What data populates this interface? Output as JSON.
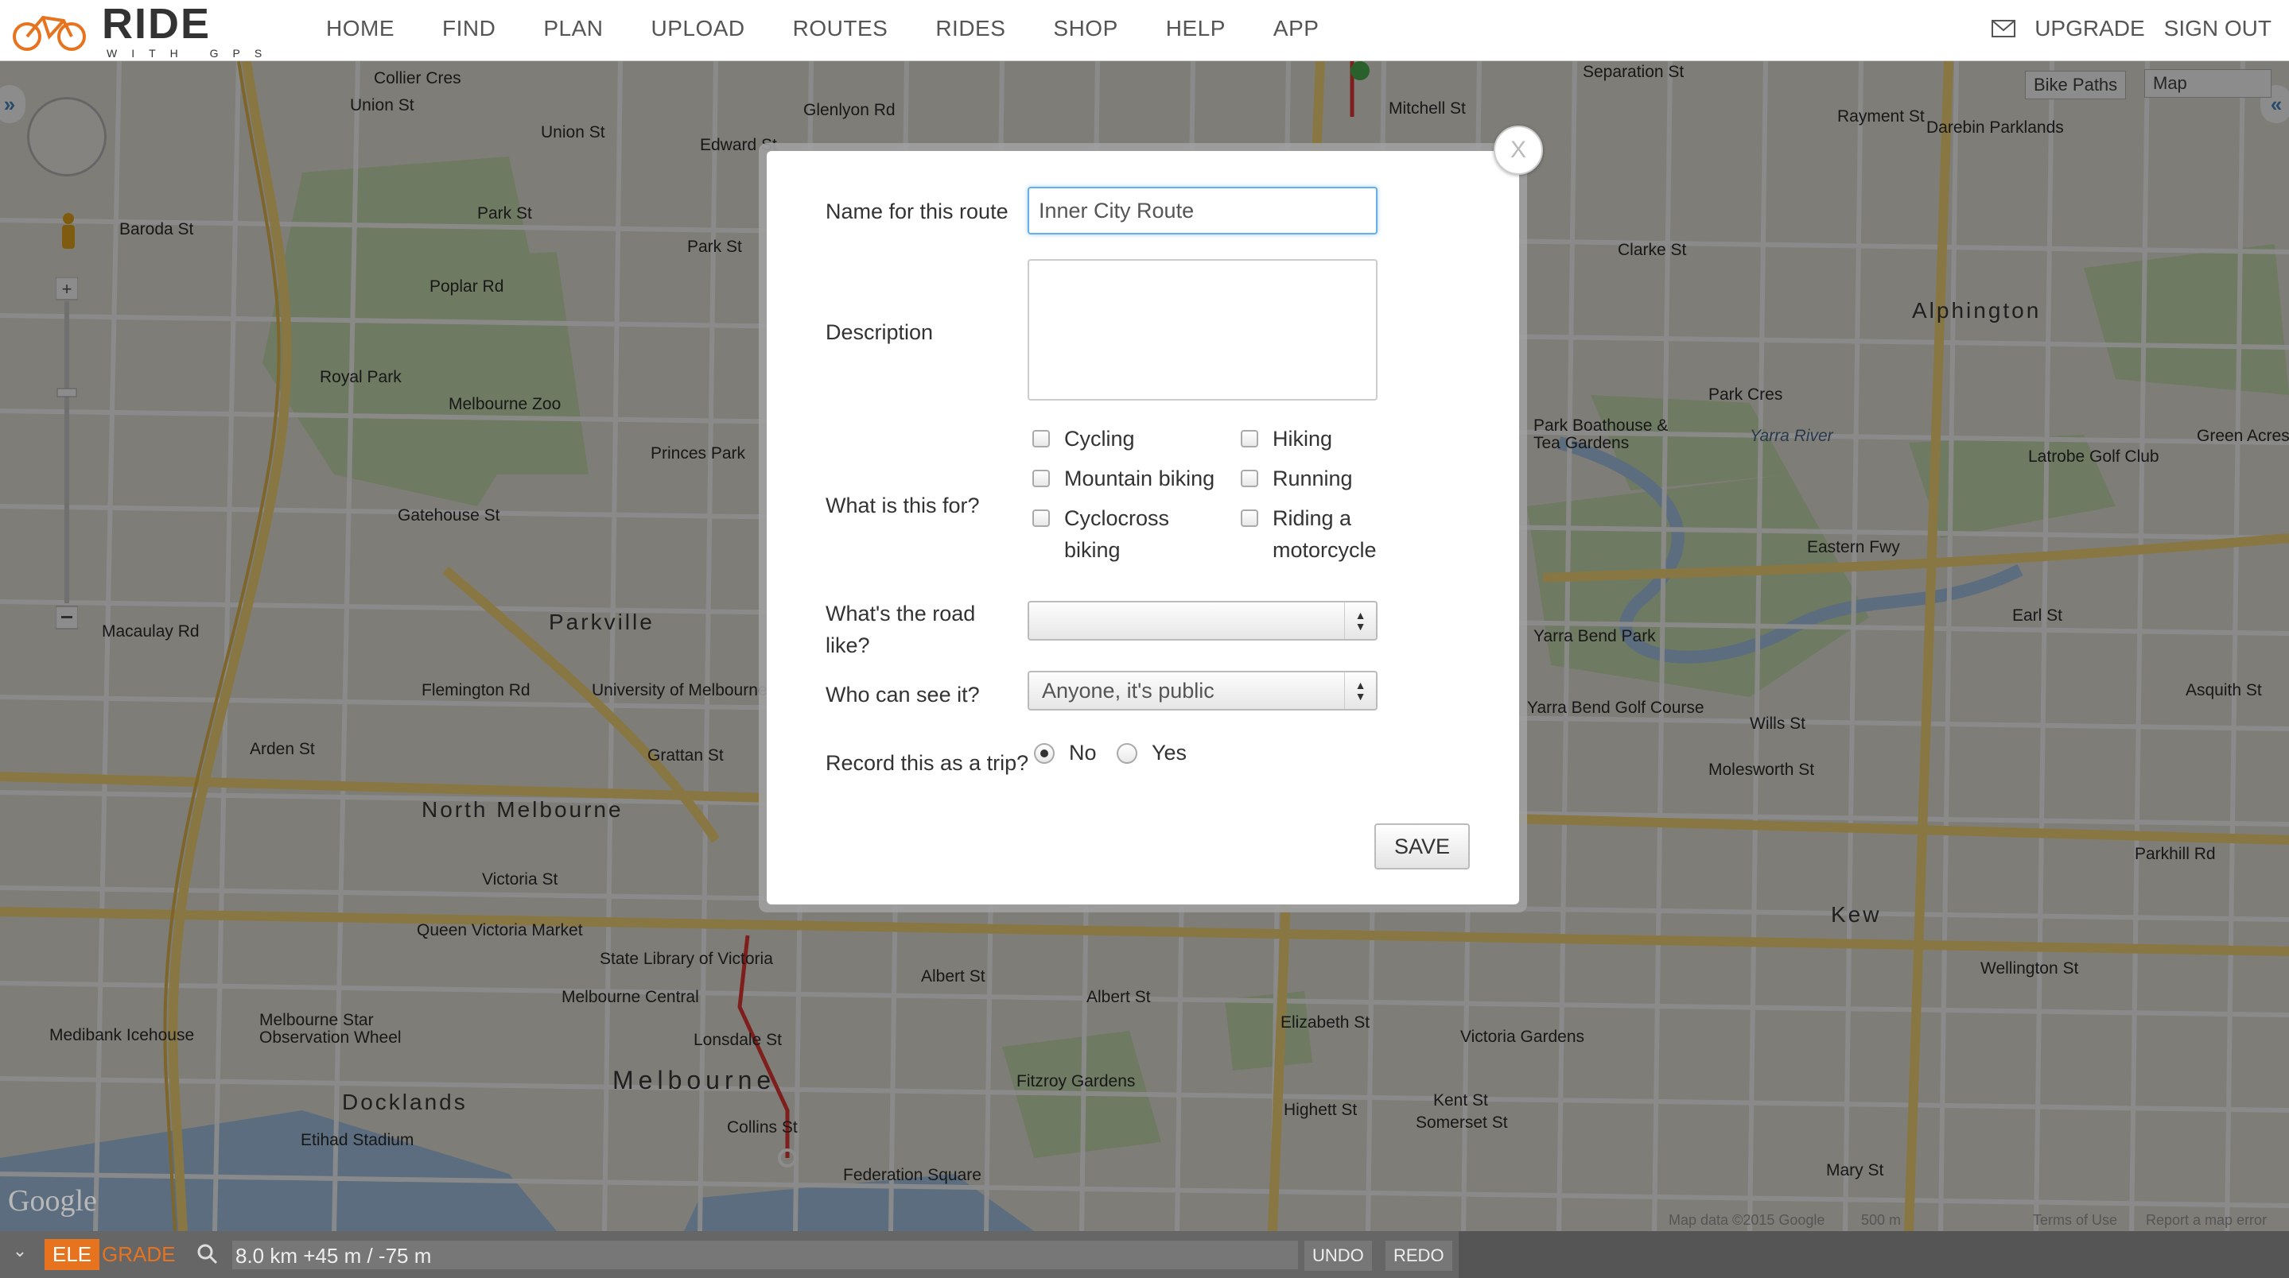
{
  "header": {
    "logo_text": "RIDE",
    "logo_sub": "WITH GPS",
    "nav": [
      "HOME",
      "FIND",
      "PLAN",
      "UPLOAD",
      "ROUTES",
      "RIDES",
      "SHOP",
      "HELP",
      "APP"
    ],
    "upgrade": "UPGRADE",
    "sign_out": "SIGN OUT"
  },
  "map": {
    "type_select": "Map",
    "bike_paths": "Bike Paths",
    "google": "Google",
    "footer_data": "Map data ©2015 Google",
    "scale": "500 m",
    "terms": "Terms of Use",
    "report": "Report a map error",
    "labels": [
      {
        "t": "Collier Cres"
      },
      {
        "t": "Union St"
      },
      {
        "t": "Glenlyon Rd"
      },
      {
        "t": "Union St"
      },
      {
        "t": "Edward St"
      },
      {
        "t": "Separation St"
      },
      {
        "t": "Mitchell St"
      },
      {
        "t": "Rayment St"
      },
      {
        "t": "Darebin Parklands"
      },
      {
        "t": "Park St"
      },
      {
        "t": "Park St"
      },
      {
        "t": "Poplar Rd"
      },
      {
        "t": "Baroda St"
      },
      {
        "t": "Royal Park"
      },
      {
        "t": "Melbourne Zoo"
      },
      {
        "t": "Princes Park"
      },
      {
        "t": "Parkville"
      },
      {
        "t": "University of Melbourne"
      },
      {
        "t": "Macaulay Rd"
      },
      {
        "t": "Arden St"
      },
      {
        "t": "North Melbourne"
      },
      {
        "t": "Victoria St"
      },
      {
        "t": "Queen Victoria Market"
      },
      {
        "t": "State Library of Victoria"
      },
      {
        "t": "Melbourne Central"
      },
      {
        "t": "Medibank Icehouse"
      },
      {
        "t": "Melbourne Star Observation Wheel"
      },
      {
        "t": "Docklands"
      },
      {
        "t": "Etihad Stadium"
      },
      {
        "t": "Melbourne"
      },
      {
        "t": "Fitzroy Gardens"
      },
      {
        "t": "Federation Square"
      },
      {
        "t": "Collins St"
      },
      {
        "t": "Albert St"
      },
      {
        "t": "Albert St"
      },
      {
        "t": "Elizabeth St"
      },
      {
        "t": "Victoria Gardens"
      },
      {
        "t": "Highett St"
      },
      {
        "t": "Kent St"
      },
      {
        "t": "Somerset St"
      },
      {
        "t": "Mary St"
      },
      {
        "t": "Kew"
      },
      {
        "t": "Wellington St"
      },
      {
        "t": "Parkhill Rd"
      },
      {
        "t": "Molesworth St"
      },
      {
        "t": "Wills St"
      },
      {
        "t": "Yarra Bend Golf Course"
      },
      {
        "t": "Yarra Bend Park"
      },
      {
        "t": "Eastern Fwy"
      },
      {
        "t": "Park Boathouse & Tea Gardens"
      },
      {
        "t": "Yarra River"
      },
      {
        "t": "Park Cres"
      },
      {
        "t": "Alphington"
      },
      {
        "t": "Clarke St"
      },
      {
        "t": "Latrobe Golf Club"
      },
      {
        "t": "Green Acres"
      },
      {
        "t": "Grattan St"
      },
      {
        "t": "Asquith St"
      },
      {
        "t": "Earl St"
      },
      {
        "t": "Gatehouse St"
      },
      {
        "t": "Flemington Rd"
      },
      {
        "t": "Lonsdale St"
      }
    ]
  },
  "modal": {
    "close": "X",
    "name_label": "Name for this route",
    "name_value": "Inner City Route",
    "desc_label": "Description",
    "desc_value": "",
    "for_label": "What is this for?",
    "activities": [
      "Cycling",
      "Hiking",
      "Mountain biking",
      "Running",
      "Cyclocross biking",
      "Riding a motorcycle"
    ],
    "road_label": "What's the road like?",
    "road_value": "",
    "visibility_label": "Who can see it?",
    "visibility_value": "Anyone, it's public",
    "trip_label": "Record this as a trip?",
    "trip_no": "No",
    "trip_yes": "Yes",
    "save": "SAVE"
  },
  "bottom": {
    "ele": "ELE",
    "grade": "GRADE",
    "stats": "8.0 km +45 m / -75 m",
    "undo": "UNDO",
    "redo": "REDO"
  },
  "colors": {
    "accent": "#e8731e",
    "focus": "#66afe9"
  }
}
